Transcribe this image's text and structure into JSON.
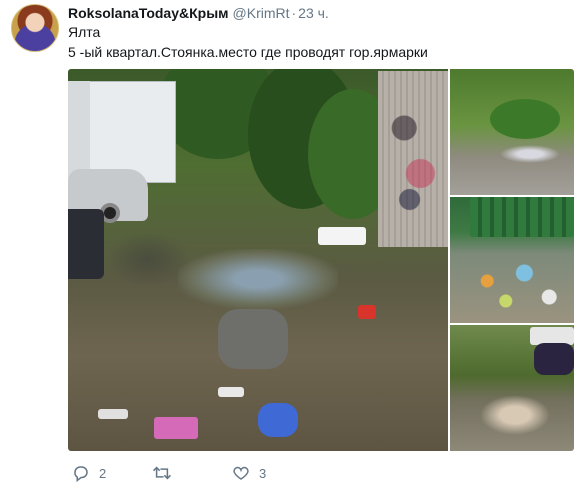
{
  "tweet": {
    "author_name": "RoksolanaToday&Крым",
    "handle": "@KrimRt",
    "separator": "·",
    "time": "23 ч.",
    "text_line1": "Ялта",
    "text_line2": "5 -ый квартал.Стоянка.место где проводят гор.ярмарки"
  },
  "actions": {
    "reply_icon": "reply-icon",
    "reply_count": "2",
    "retweet_icon": "retweet-icon",
    "retweet_count": "",
    "like_icon": "heart-icon",
    "like_count": "3"
  },
  "colors": {
    "text": "#14171a",
    "secondary": "#657786"
  }
}
